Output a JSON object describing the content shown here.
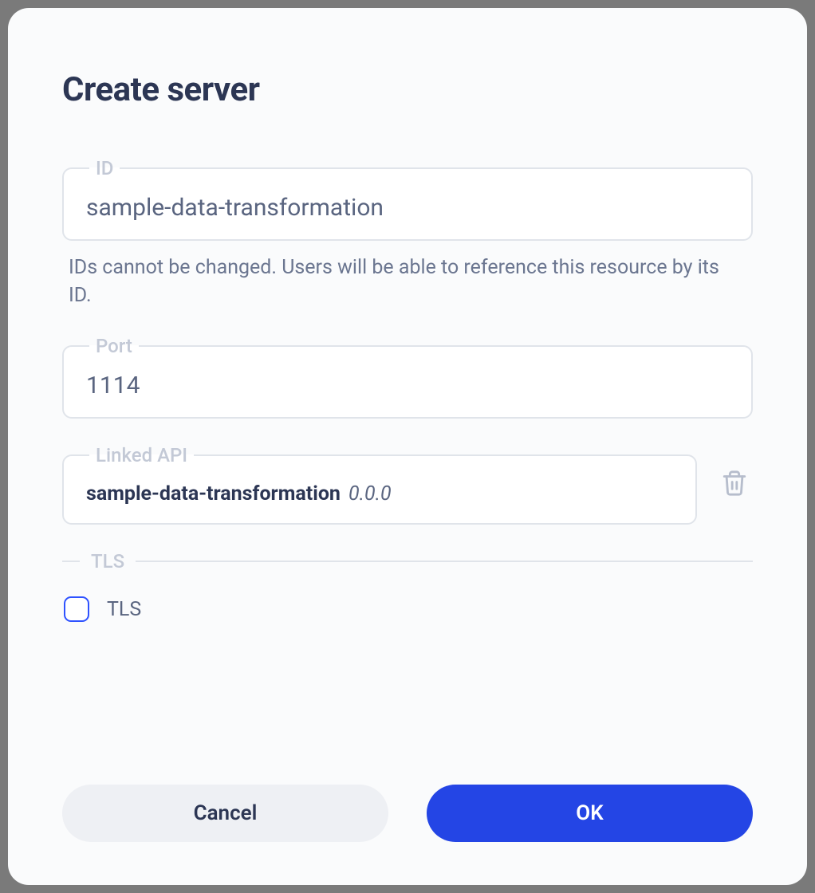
{
  "modal": {
    "title": "Create server"
  },
  "fields": {
    "id": {
      "label": "ID",
      "value": "sample-data-transformation",
      "helper": "IDs cannot be changed. Users will be able to reference this resource by its ID."
    },
    "port": {
      "label": "Port",
      "value": "1114"
    },
    "linkedApi": {
      "label": "Linked API",
      "name": "sample-data-transformation",
      "version": "0.0.0"
    },
    "tls": {
      "sectionLabel": "TLS",
      "checkboxLabel": "TLS",
      "checked": false
    }
  },
  "buttons": {
    "cancel": "Cancel",
    "ok": "OK"
  }
}
